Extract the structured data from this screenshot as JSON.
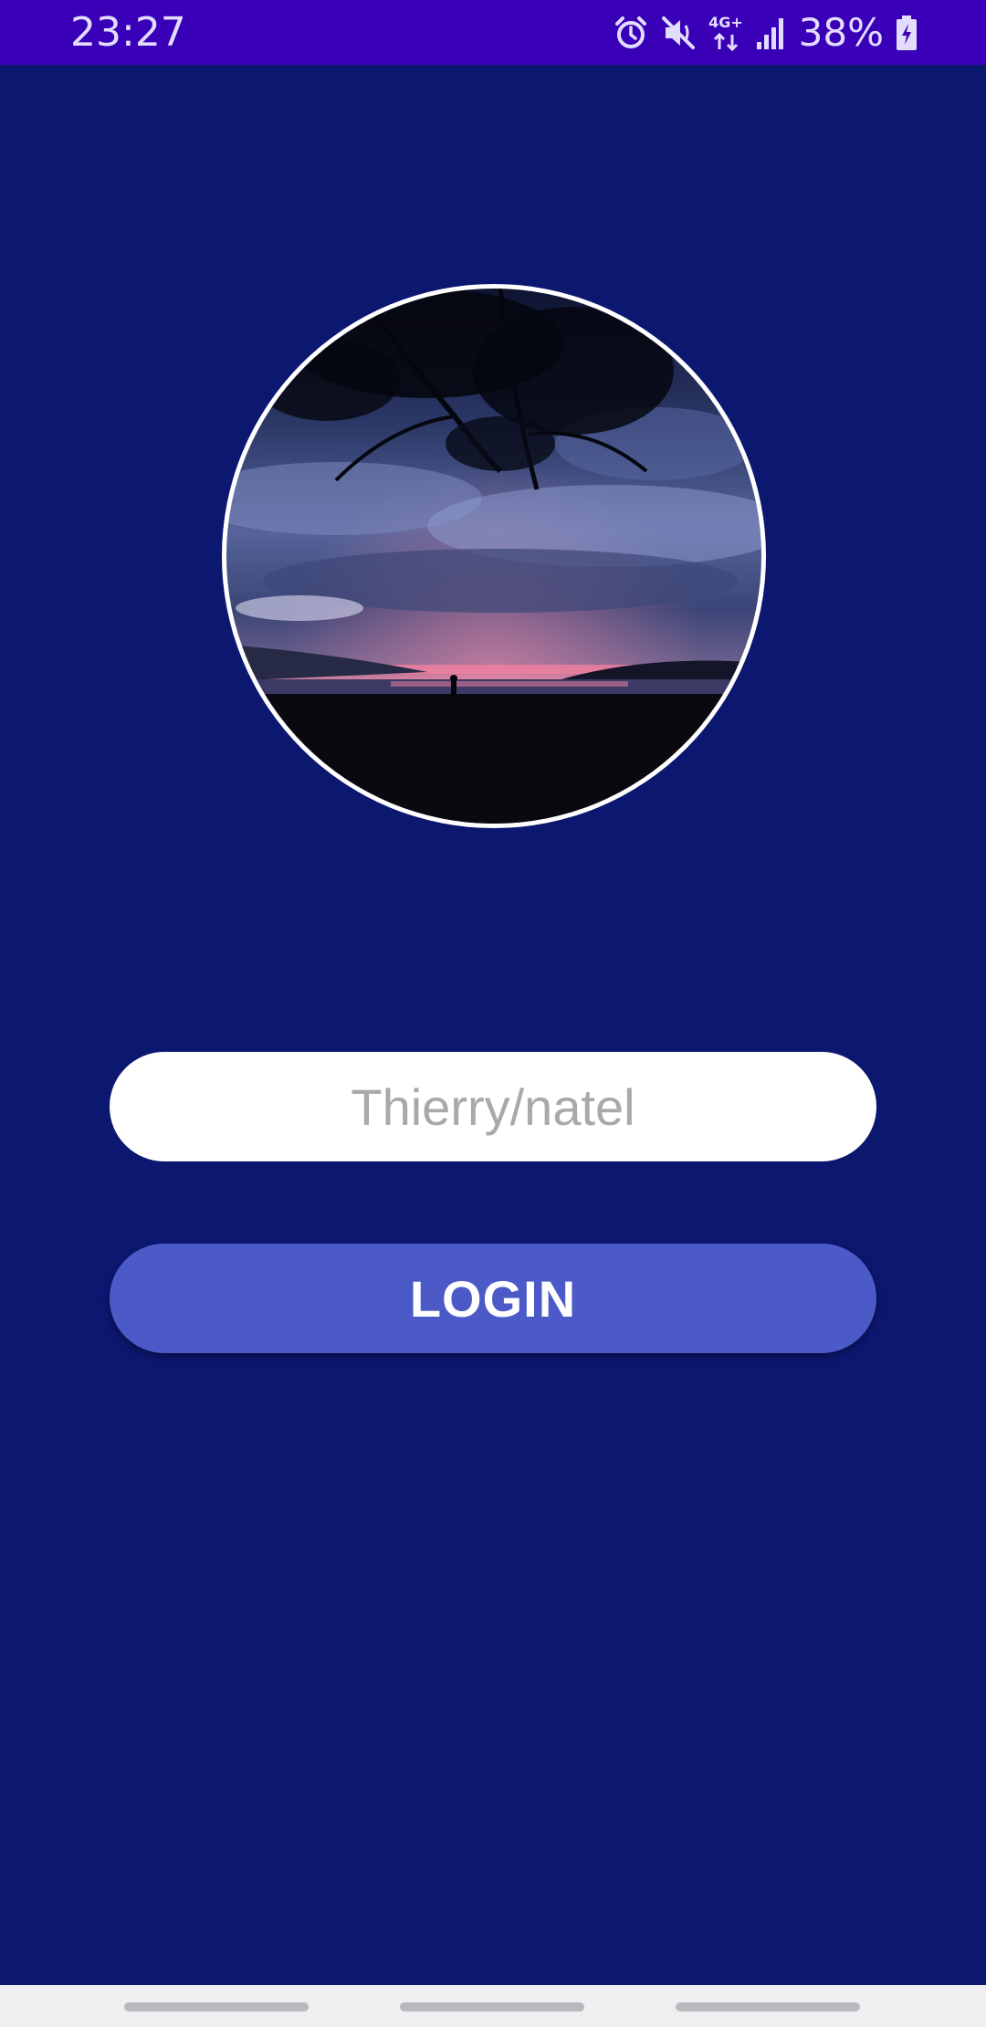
{
  "status_bar": {
    "time": "23:27",
    "network_label": "4G+",
    "battery_percent": "38%",
    "icons": [
      "alarm-icon",
      "mute-vibrate-icon",
      "mobile-data-icon",
      "signal-icon",
      "battery-charging-icon"
    ],
    "background_color": "#3a00b8"
  },
  "profile": {
    "image_description_icon": "profile-photo"
  },
  "login_form": {
    "username_placeholder": "Thierry/natel",
    "username_value": "",
    "login_label": "LOGIN"
  },
  "nav_bar": {
    "items": [
      "recents",
      "home",
      "back"
    ]
  },
  "colors": {
    "background": "#0c1770",
    "button": "#4b5ac7",
    "input": "#ffffff"
  }
}
